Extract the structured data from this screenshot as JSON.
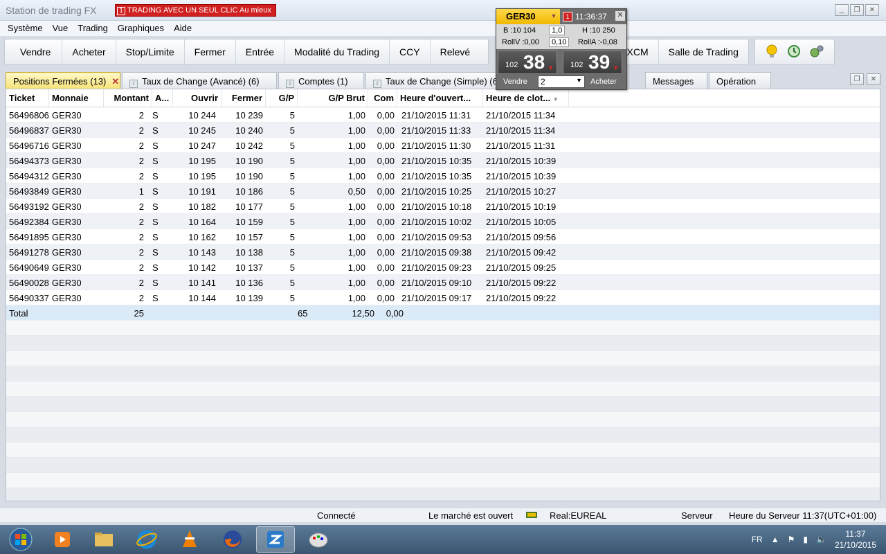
{
  "window": {
    "title": "Station de trading FX",
    "oneclick_num": "1",
    "oneclick_label": "TRADING AVEC UN SEUL CLIC Au mieux"
  },
  "menu": [
    "Système",
    "Vue",
    "Trading",
    "Graphiques",
    "Aide"
  ],
  "toolbar": {
    "buttons": [
      "Vendre",
      "Acheter",
      "Stop/Limite",
      "Fermer",
      "Entrée",
      "Modalité du Trading",
      "CCY",
      "Relevé"
    ],
    "buttons_right": [
      "FXCM",
      "Salle de Trading"
    ]
  },
  "tabs": [
    {
      "label": "Positions Fermées (13)",
      "icon": "close-icon"
    },
    {
      "label": "Taux de Change (Avancé) (6)"
    },
    {
      "label": "Comptes (1)"
    },
    {
      "label": "Taux de Change (Simple) (6)"
    },
    {
      "label": "Messages"
    },
    {
      "label": "Opération"
    }
  ],
  "table": {
    "headers": [
      "Ticket",
      "Monnaie",
      "Montant",
      "A...",
      "Ouvrir",
      "Fermer",
      "G/P",
      "G/P Brut",
      "Com",
      "Heure d'ouvert...",
      "Heure de clot..."
    ],
    "rows": [
      [
        "56496806",
        "GER30",
        "2",
        "S",
        "10 244",
        "10 239",
        "5",
        "1,00",
        "0,00",
        "21/10/2015 11:31",
        "21/10/2015 11:34"
      ],
      [
        "56496837",
        "GER30",
        "2",
        "S",
        "10 245",
        "10 240",
        "5",
        "1,00",
        "0,00",
        "21/10/2015 11:33",
        "21/10/2015 11:34"
      ],
      [
        "56496716",
        "GER30",
        "2",
        "S",
        "10 247",
        "10 242",
        "5",
        "1,00",
        "0,00",
        "21/10/2015 11:30",
        "21/10/2015 11:31"
      ],
      [
        "56494373",
        "GER30",
        "2",
        "S",
        "10 195",
        "10 190",
        "5",
        "1,00",
        "0,00",
        "21/10/2015 10:35",
        "21/10/2015 10:39"
      ],
      [
        "56494312",
        "GER30",
        "2",
        "S",
        "10 195",
        "10 190",
        "5",
        "1,00",
        "0,00",
        "21/10/2015 10:35",
        "21/10/2015 10:39"
      ],
      [
        "56493849",
        "GER30",
        "1",
        "S",
        "10 191",
        "10 186",
        "5",
        "0,50",
        "0,00",
        "21/10/2015 10:25",
        "21/10/2015 10:27"
      ],
      [
        "56493192",
        "GER30",
        "2",
        "S",
        "10 182",
        "10 177",
        "5",
        "1,00",
        "0,00",
        "21/10/2015 10:18",
        "21/10/2015 10:19"
      ],
      [
        "56492384",
        "GER30",
        "2",
        "S",
        "10 164",
        "10 159",
        "5",
        "1,00",
        "0,00",
        "21/10/2015 10:02",
        "21/10/2015 10:05"
      ],
      [
        "56491895",
        "GER30",
        "2",
        "S",
        "10 162",
        "10 157",
        "5",
        "1,00",
        "0,00",
        "21/10/2015 09:53",
        "21/10/2015 09:56"
      ],
      [
        "56491278",
        "GER30",
        "2",
        "S",
        "10 143",
        "10 138",
        "5",
        "1,00",
        "0,00",
        "21/10/2015 09:38",
        "21/10/2015 09:42"
      ],
      [
        "56490649",
        "GER30",
        "2",
        "S",
        "10 142",
        "10 137",
        "5",
        "1,00",
        "0,00",
        "21/10/2015 09:23",
        "21/10/2015 09:25"
      ],
      [
        "56490028",
        "GER30",
        "2",
        "S",
        "10 141",
        "10 136",
        "5",
        "1,00",
        "0,00",
        "21/10/2015 09:10",
        "21/10/2015 09:22"
      ],
      [
        "56490337",
        "GER30",
        "2",
        "S",
        "10 144",
        "10 139",
        "5",
        "1,00",
        "0,00",
        "21/10/2015 09:17",
        "21/10/2015 09:22"
      ]
    ],
    "total": {
      "label": "Total",
      "montant": "25",
      "gp": "65",
      "gp_brut": "12,50",
      "com": "0,00"
    }
  },
  "widget": {
    "symbol": "GER30",
    "badge": "1",
    "time": "11:36:37",
    "low": "B :10 104",
    "lot": "1,0",
    "high": "H :10 250",
    "rollv": "RollV :0,00",
    "pip": "0,10",
    "rolla": "RollA :-0,08",
    "sell_small": "102",
    "sell_big": "38",
    "buy_small": "102",
    "buy_big": "39",
    "sell_label": "Vendre",
    "amount": "2",
    "buy_label": "Acheter"
  },
  "status": {
    "connected": "Connecté",
    "market": "Le marché est ouvert",
    "account": "Real:EUREAL",
    "server": "Serveur",
    "server_time": "Heure du Serveur 11:37(UTC+01:00)"
  },
  "taskbar": {
    "lang": "FR",
    "time": "11:37",
    "date": "21/10/2015"
  },
  "colors": {
    "accent_tab": "#f7e37a",
    "alert_red": "#d02020",
    "widget_gold": "#f0b800"
  }
}
